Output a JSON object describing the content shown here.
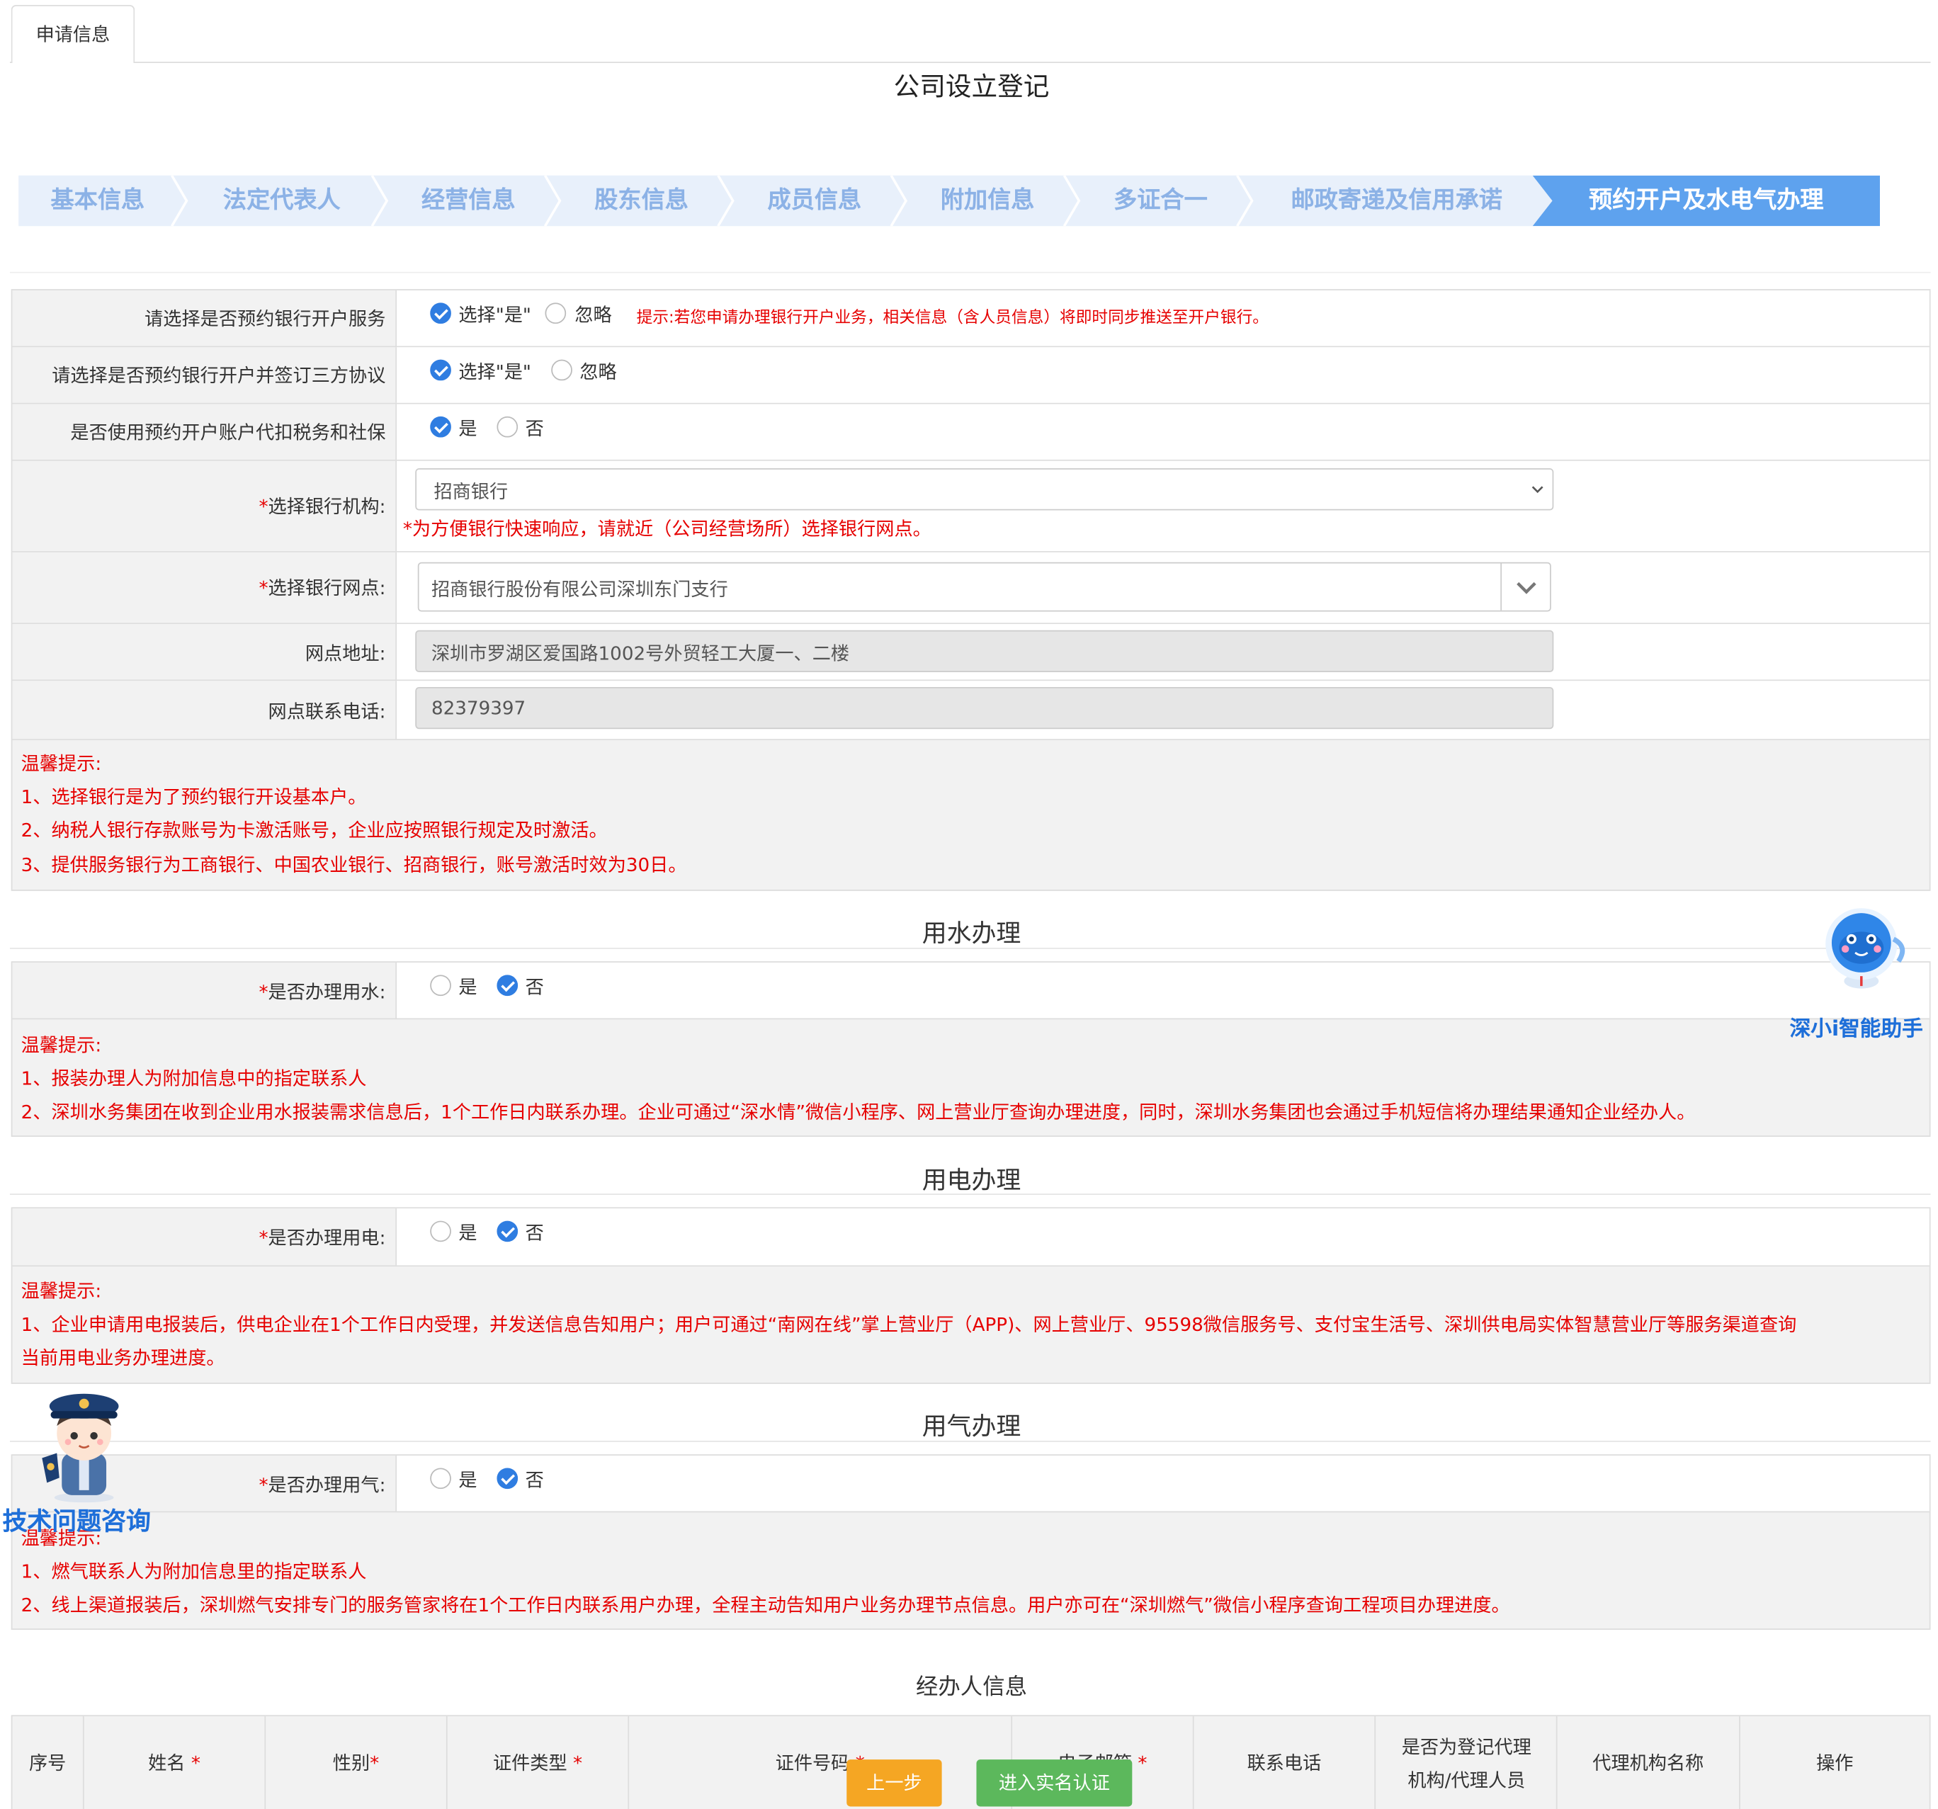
{
  "tab": {
    "label": "申请信息"
  },
  "page_title": "公司设立登记",
  "steps": [
    "基本信息",
    "法定代表人",
    "经营信息",
    "股东信息",
    "成员信息",
    "附加信息",
    "多证合一",
    "邮政寄递及信用承诺",
    "预约开户及水电气办理"
  ],
  "bank": {
    "q1": {
      "label": "请选择是否预约银行开户服务",
      "opt_yes": "选择\"是\"",
      "opt_no": "忽略",
      "hint": "提示:若您申请办理银行开户业务，相关信息（含人员信息）将即时同步推送至开户银行。"
    },
    "q2": {
      "label": "请选择是否预约银行开户并签订三方协议",
      "opt_yes": "选择\"是\"",
      "opt_no": "忽略"
    },
    "q3": {
      "label": "是否使用预约开户账户代扣税务和社保",
      "opt_yes": "是",
      "opt_no": "否"
    },
    "institution": {
      "req": "*",
      "label": "选择银行机构:",
      "value": "招商银行",
      "hint": "*为方便银行快速响应，请就近（公司经营场所）选择银行网点。"
    },
    "branch": {
      "req": "*",
      "label": "选择银行网点:",
      "value": "招商银行股份有限公司深圳东门支行"
    },
    "address": {
      "label": "网点地址:",
      "value": "深圳市罗湖区爱国路1002号外贸轻工大厦一、二楼"
    },
    "phone": {
      "label": "网点联系电话:",
      "value": "82379397"
    },
    "tips": [
      "温馨提示:",
      "1、选择银行是为了预约银行开设基本户。",
      "2、纳税人银行存款账号为卡激活账号，企业应按照银行规定及时激活。",
      "3、提供服务银行为工商银行、中国农业银行、招商银行，账号激活时效为30日。"
    ]
  },
  "water": {
    "title": "用水办理",
    "req": "*",
    "label": "是否办理用水:",
    "opt_yes": "是",
    "opt_no": "否",
    "tips": [
      "温馨提示:",
      "1、报装办理人为附加信息中的指定联系人",
      "2、深圳水务集团在收到企业用水报装需求信息后，1个工作日内联系办理。企业可通过“深水情”微信小程序、网上营业厅查询办理进度，同时，深圳水务集团也会通过手机短信将办理结果通知企业经办人。"
    ]
  },
  "power": {
    "title": "用电办理",
    "req": "*",
    "label": "是否办理用电:",
    "opt_yes": "是",
    "opt_no": "否",
    "tips": [
      "温馨提示:",
      "1、企业申请用电报装后，供电企业在1个工作日内受理，并发送信息告知用户；用户可通过“南网在线”掌上营业厅（APP)、网上营业厅、95598微信服务号、支付宝生活号、深圳供电局实体智慧营业厅等服务渠道查询",
      "当前用电业务办理进度。"
    ]
  },
  "gas": {
    "title": "用气办理",
    "req": "*",
    "label": "是否办理用气:",
    "opt_yes": "是",
    "opt_no": "否",
    "tips": [
      "温馨提示:",
      "1、燃气联系人为附加信息里的指定联系人",
      "2、线上渠道报装后，深圳燃气安排专门的服务管家将在1个工作日内联系用户办理，全程主动告知用户业务办理节点信息。用户亦可在“深圳燃气”微信小程序查询工程项目办理进度。"
    ]
  },
  "agent": {
    "title": "经办人信息",
    "columns": [
      "序号",
      "姓名",
      "性别",
      "证件类型",
      "证件号码",
      "电子邮箱",
      "联系电话",
      "是否为登记代理",
      "机构/代理人员",
      "代理机构名称",
      "操作"
    ],
    "req_mark": "*"
  },
  "buttons": {
    "prev": "上一步",
    "next": "进入实名认证"
  },
  "assistant": {
    "label": "深小i智能助手"
  },
  "tech_support": {
    "label": "技术问题咨询"
  },
  "colors": {
    "primary": "#2f7de1",
    "step_active": "#5ea2ee",
    "warning": "#e60000",
    "prev_btn": "#f5a623",
    "next_btn": "#5cb85c"
  }
}
